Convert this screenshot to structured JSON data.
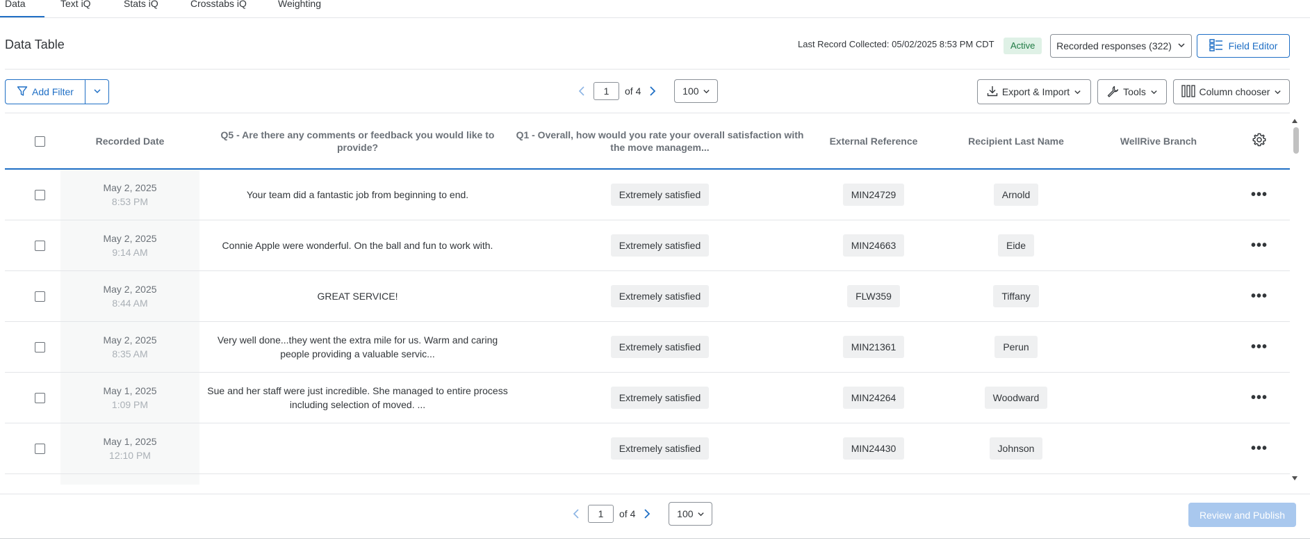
{
  "tabs": [
    {
      "label": "Data"
    },
    {
      "label": "Text iQ"
    },
    {
      "label": "Stats iQ"
    },
    {
      "label": "Crosstabs iQ"
    },
    {
      "label": "Weighting"
    }
  ],
  "header": {
    "title": "Data Table",
    "last_record": "Last Record Collected: 05/02/2025 8:53 PM CDT",
    "status_badge": "Active",
    "recorded_label": "Recorded responses (322)",
    "field_editor_label": "Field Editor"
  },
  "toolbar": {
    "add_filter_label": "Add Filter",
    "page_value": "1",
    "page_of": "of 4",
    "page_size": "100",
    "export_label": "Export & Import",
    "tools_label": "Tools",
    "column_chooser_label": "Column chooser"
  },
  "table": {
    "headers": {
      "recorded_date": "Recorded Date",
      "q5": "Q5 - Are there any comments or feedback you would like to provide?",
      "q1": "Q1 - Overall, how would you rate your overall satisfaction with the move managem...",
      "external_ref": "External Reference",
      "last_name": "Recipient Last Name",
      "branch": "WellRive Branch"
    },
    "rows": [
      {
        "date": "May 2, 2025",
        "time": "8:53 PM",
        "comment": "Your team did a fantastic job from beginning to end.",
        "satisfaction": "Extremely satisfied",
        "ref": "MIN24729",
        "last_name": "Arnold",
        "branch": ""
      },
      {
        "date": "May 2, 2025",
        "time": "9:14 AM",
        "comment": "Connie Apple were wonderful. On the ball and fun to work with.",
        "satisfaction": "Extremely satisfied",
        "ref": "MIN24663",
        "last_name": "Eide",
        "branch": ""
      },
      {
        "date": "May 2, 2025",
        "time": "8:44 AM",
        "comment": "GREAT SERVICE!",
        "satisfaction": "Extremely satisfied",
        "ref": "FLW359",
        "last_name": "Tiffany",
        "branch": ""
      },
      {
        "date": "May 2, 2025",
        "time": "8:35 AM",
        "comment": "Very well done...they went the extra mile for us. Warm and caring people providing a valuable servic...",
        "satisfaction": "Extremely satisfied",
        "ref": "MIN21361",
        "last_name": "Perun",
        "branch": ""
      },
      {
        "date": "May 1, 2025",
        "time": "1:09 PM",
        "comment": "Sue and her staff were just incredible. She managed to entire process including selection of moved. ...",
        "satisfaction": "Extremely satisfied",
        "ref": "MIN24264",
        "last_name": "Woodward",
        "branch": ""
      },
      {
        "date": "May 1, 2025",
        "time": "12:10 PM",
        "comment": "",
        "satisfaction": "Extremely satisfied",
        "ref": "MIN24430",
        "last_name": "Johnson",
        "branch": ""
      }
    ]
  },
  "footer": {
    "page_value": "1",
    "page_of": "of 4",
    "page_size": "100",
    "review_label": "Review and Publish"
  },
  "colors": {
    "accent": "#1f6fc5",
    "active_badge_bg": "#dff1e6",
    "active_badge_text": "#1e7a43",
    "review_disabled": "#a9c8ee"
  }
}
